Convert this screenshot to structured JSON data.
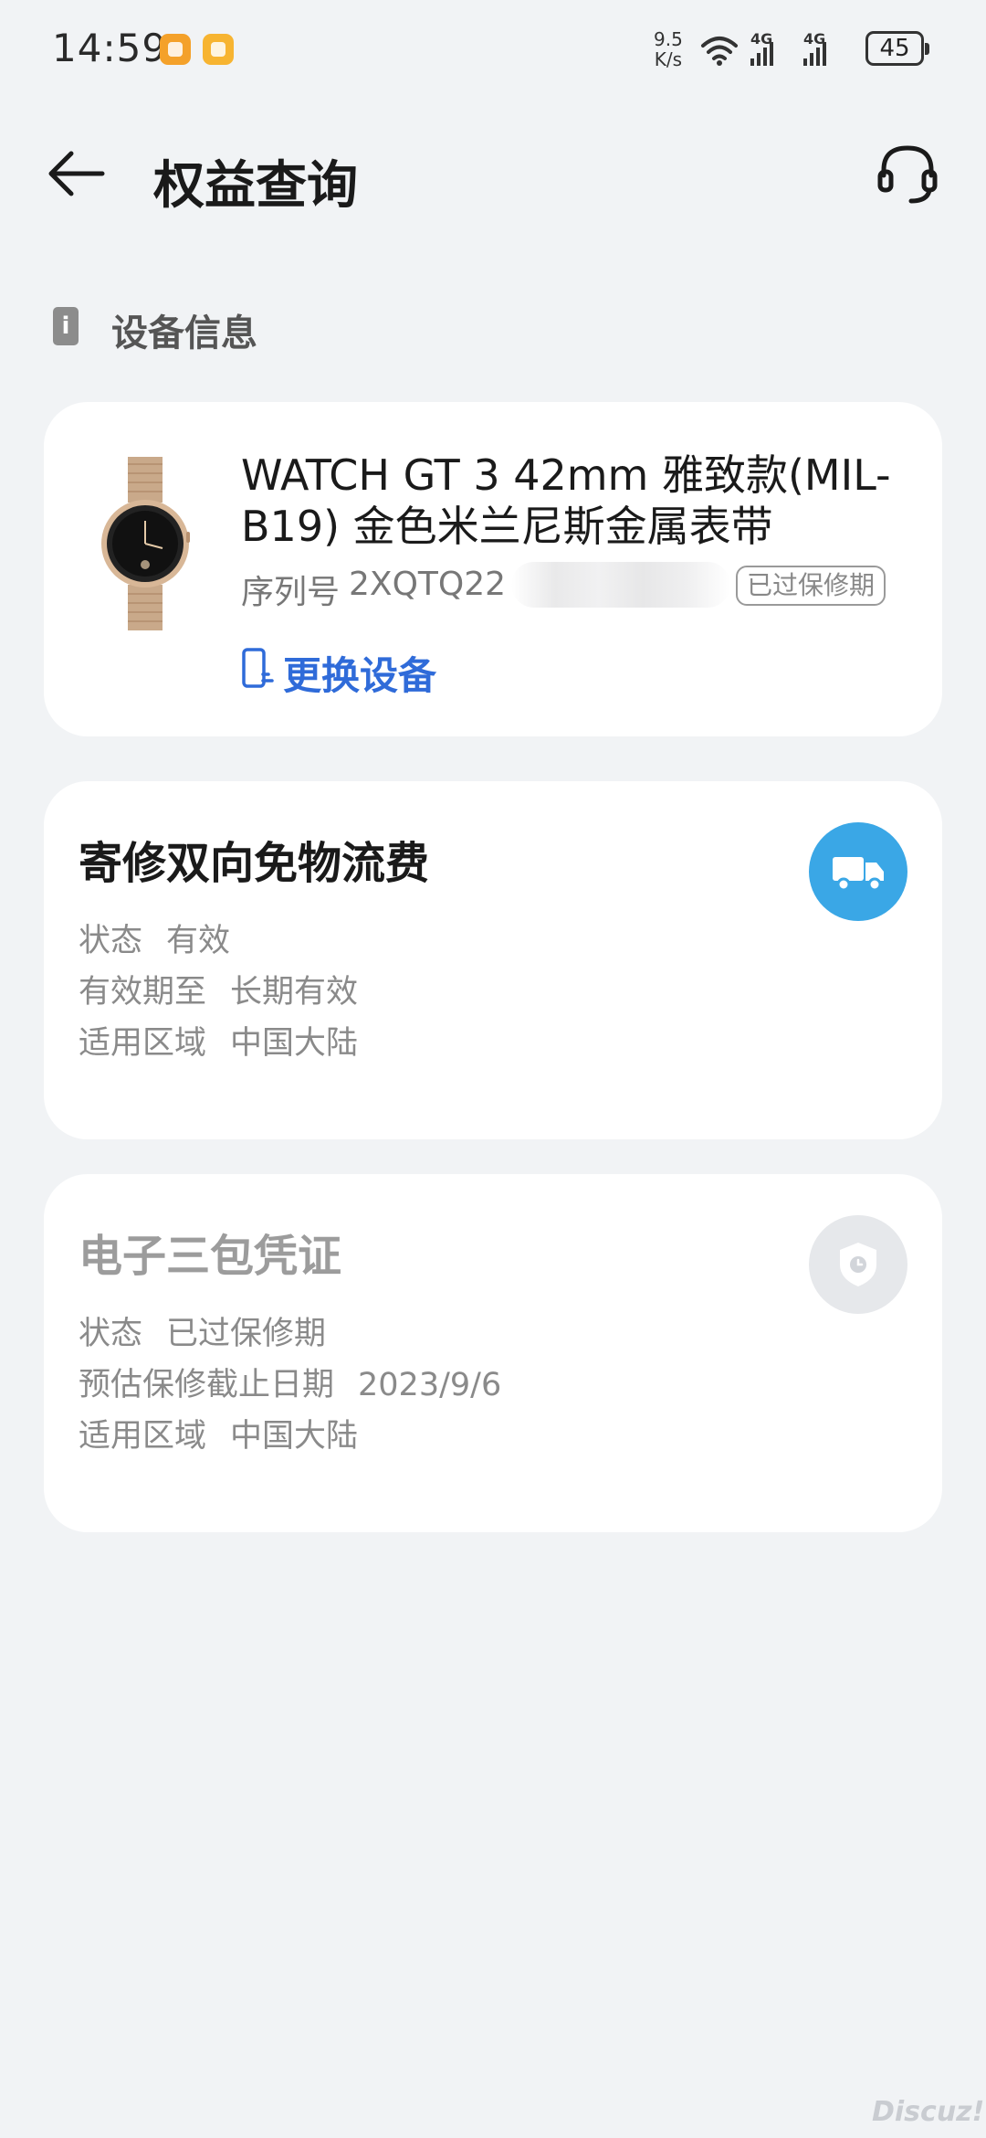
{
  "status_bar": {
    "time": "14:59",
    "net_speed_value": "9.5",
    "net_speed_unit": "K/s",
    "signal_1": "4G",
    "signal_2": "4G",
    "battery": "45"
  },
  "header": {
    "title": "权益查询"
  },
  "device_section": {
    "title": "设备信息",
    "info_icon": "i"
  },
  "device": {
    "name": "WATCH GT 3 42mm 雅致款(MIL-B19) 金色米兰尼斯金属表带",
    "serial_label": "序列号",
    "serial_value": "2XQTQ22",
    "warranty_badge": "已过保修期",
    "change_device_label": "更换设备"
  },
  "rights_card": {
    "title": "寄修双向免物流费",
    "icon": "truck-icon",
    "icon_color": "#3aa7e6",
    "rows": [
      {
        "key": "状态",
        "value": "有效"
      },
      {
        "key": "有效期至",
        "value": "长期有效"
      },
      {
        "key": "适用区域",
        "value": "中国大陆"
      }
    ]
  },
  "warranty_card": {
    "title": "电子三包凭证",
    "icon": "shield-clock-icon",
    "rows": [
      {
        "key": "状态",
        "value": "已过保修期"
      },
      {
        "key": "预估保修截止日期",
        "value": "2023/9/6"
      },
      {
        "key": "适用区域",
        "value": "中国大陆"
      }
    ]
  },
  "watermark": "Discuz!"
}
